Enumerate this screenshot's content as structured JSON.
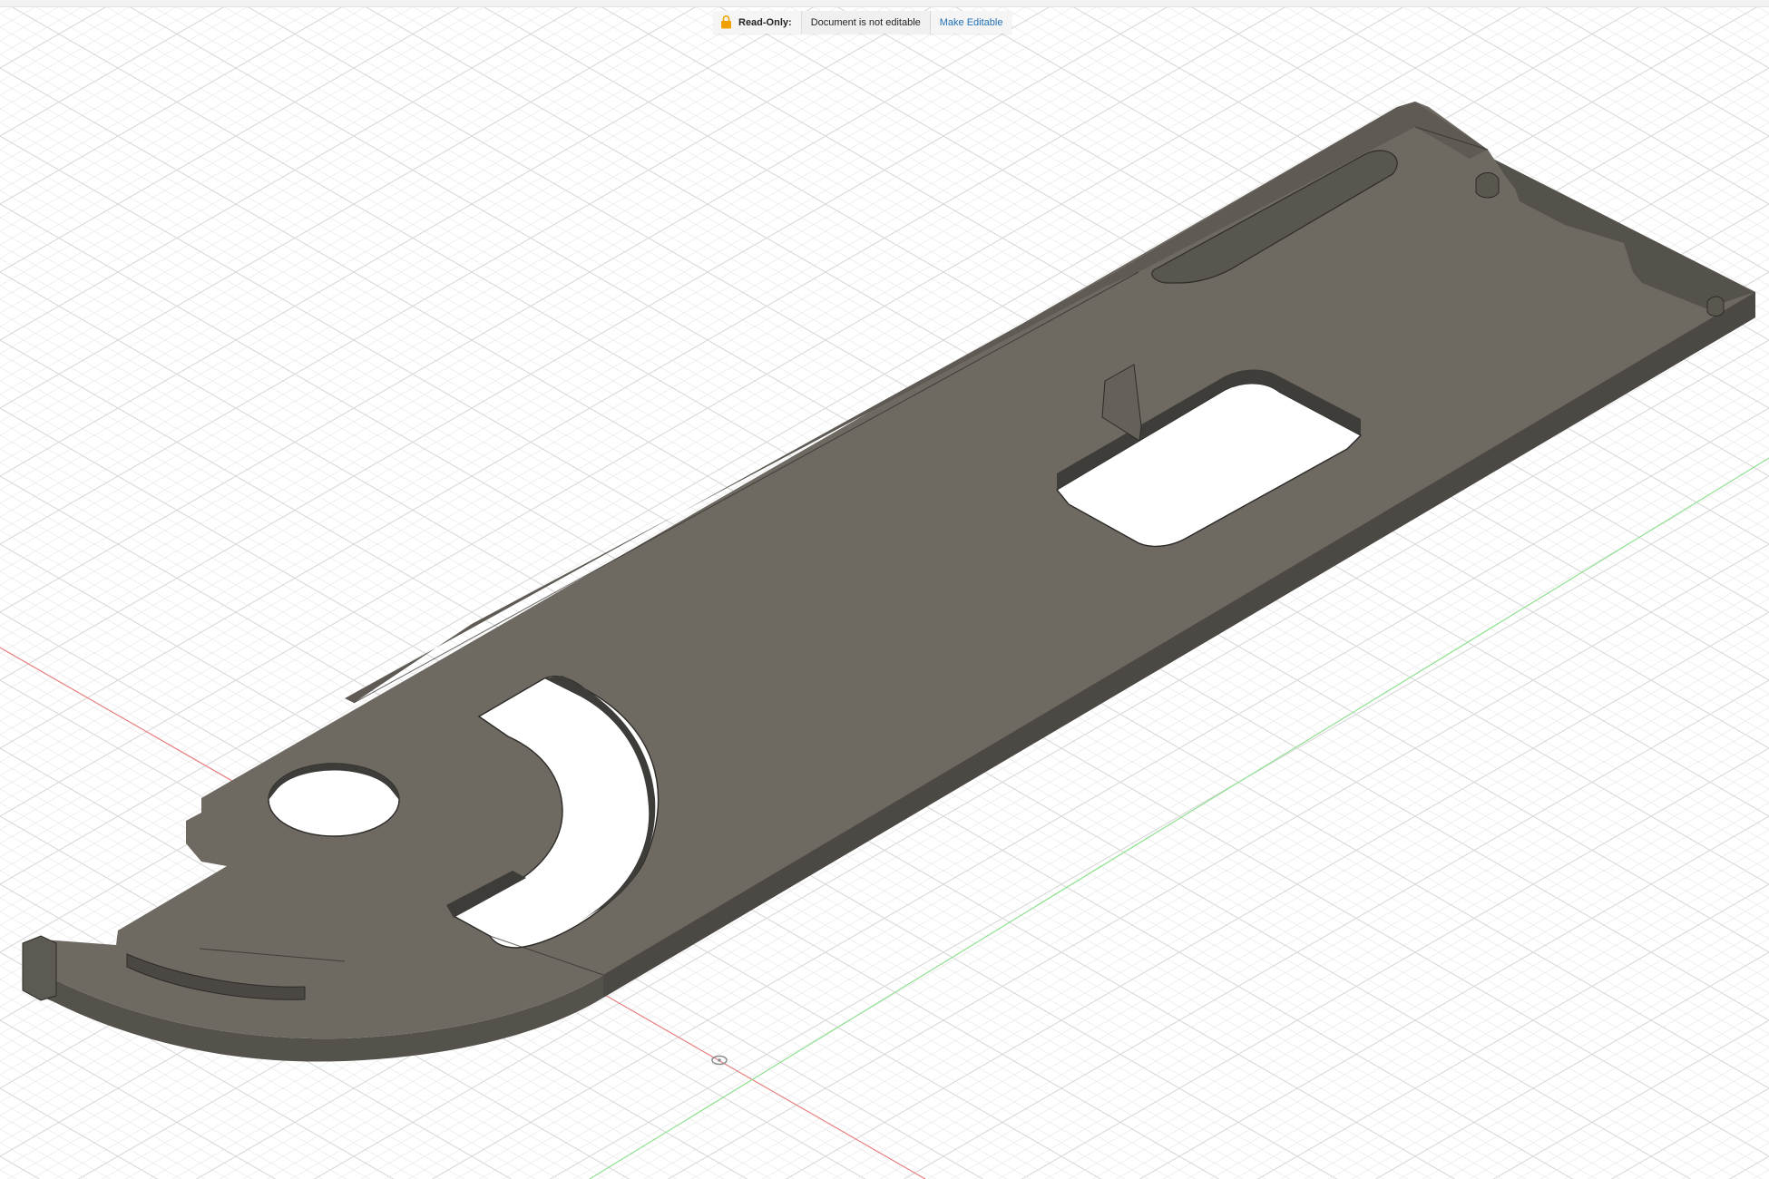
{
  "banner": {
    "status_label": "Read-Only:",
    "message": "Document is not editable",
    "action_label": "Make Editable",
    "icon": "lock-icon",
    "icon_color": "#f0a000",
    "action_color": "#1f6fb5"
  },
  "viewport": {
    "background": "#ffffff",
    "grid_minor_color": "#ececec",
    "grid_major_color": "#d4d4d4",
    "x_axis_color": "#e88080",
    "y_axis_color": "#8fe08f",
    "model_top_color": "#6e6a62",
    "model_side_color": "#55524c",
    "model_dark_color": "#494640"
  }
}
